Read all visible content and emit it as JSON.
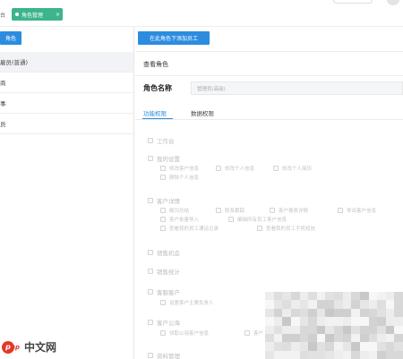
{
  "topbar": {
    "left_tab": "台",
    "active_tab": "角色管理",
    "active_tab_close": "×"
  },
  "left": {
    "add_button": "角色",
    "items": [
      "雇员(普通)",
      "商",
      "事",
      "员"
    ]
  },
  "right": {
    "add_button": "在此角色下添加员工",
    "view_title": "查看角色",
    "role_name_label": "角色名称",
    "role_name_value": "管理员(高级)",
    "tabs": [
      "功能权限",
      "数据权限"
    ]
  },
  "permissions": [
    {
      "label": "工作台",
      "children": []
    },
    {
      "label": "我的设置",
      "children": [
        [
          "修改客户信息",
          "修改个人信息",
          "修改个人简历"
        ],
        [
          "删除个人信息"
        ]
      ]
    },
    {
      "label": "客户详情",
      "children": [
        [
          "概况总结",
          "联系跟踪",
          "客户报表详情",
          "导出客户信息"
        ],
        [
          "客户批量导入",
          "编辑所有员工客户信息"
        ],
        [
          "查看我的员工通话记录",
          "查看我的员工手机短信"
        ]
      ]
    },
    {
      "label": "销售机会",
      "children": []
    },
    {
      "label": "销售统计",
      "children": []
    },
    {
      "label": "客服客户",
      "children": [
        [
          "设置客户主要负责人"
        ]
      ]
    },
    {
      "label": "客户公海",
      "children": [
        [
          "领取公海客户信息",
          "客户"
        ]
      ]
    },
    {
      "label": "资料管理",
      "children": []
    }
  ],
  "watermark": {
    "logo_letter": "p",
    "logo_hp": "hp",
    "text": "中文网"
  },
  "colors": {
    "accent": "#2b8ce0",
    "tab_green": "#3cb48e",
    "brand_red": "#e0392a"
  }
}
